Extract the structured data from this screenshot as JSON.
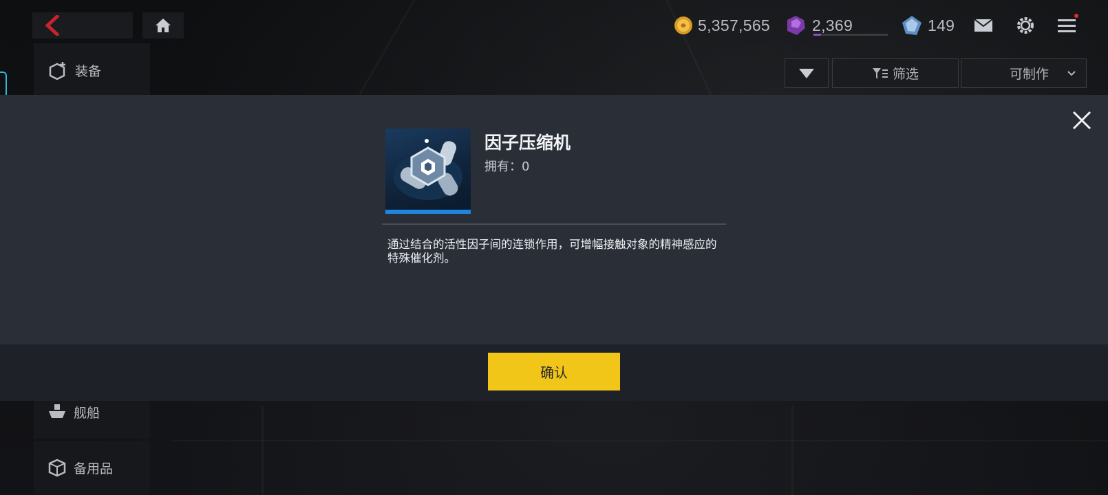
{
  "header": {
    "back_icon": "chevron-left-icon",
    "home_icon": "home-icon",
    "resources": {
      "gold": {
        "icon": "gold-coin-icon",
        "value": "5,357,565"
      },
      "ore": {
        "icon": "purple-ore-icon",
        "value": "2,369",
        "progress": 0.1
      },
      "gem": {
        "icon": "blue-crystal-icon",
        "value": "149"
      }
    },
    "mail_icon": "mail-icon",
    "settings_icon": "gear-icon",
    "menu_icon": "menu-icon"
  },
  "sidebar": {
    "items": [
      {
        "label": "装备",
        "icon": "equipment-icon"
      },
      {
        "label": "舰船",
        "icon": "ship-icon"
      },
      {
        "label": "备用品",
        "icon": "box-icon"
      }
    ]
  },
  "filters": {
    "sort_icon": "triangle-down-icon",
    "filter_label": "筛选",
    "craftable_label": "可制作"
  },
  "modal": {
    "item_name": "因子压缩机",
    "owned_label": "拥有：",
    "owned_value": "0",
    "description": "通过结合的活性因子间的连锁作用，可增幅接触对象的精神感应的特殊催化剂。",
    "confirm_label": "确认",
    "rarity_color": "#1f86e0"
  },
  "colors": {
    "accent_yellow": "#f2c619",
    "back_red": "#c8232a",
    "modal_bg": "#2a2e37"
  }
}
